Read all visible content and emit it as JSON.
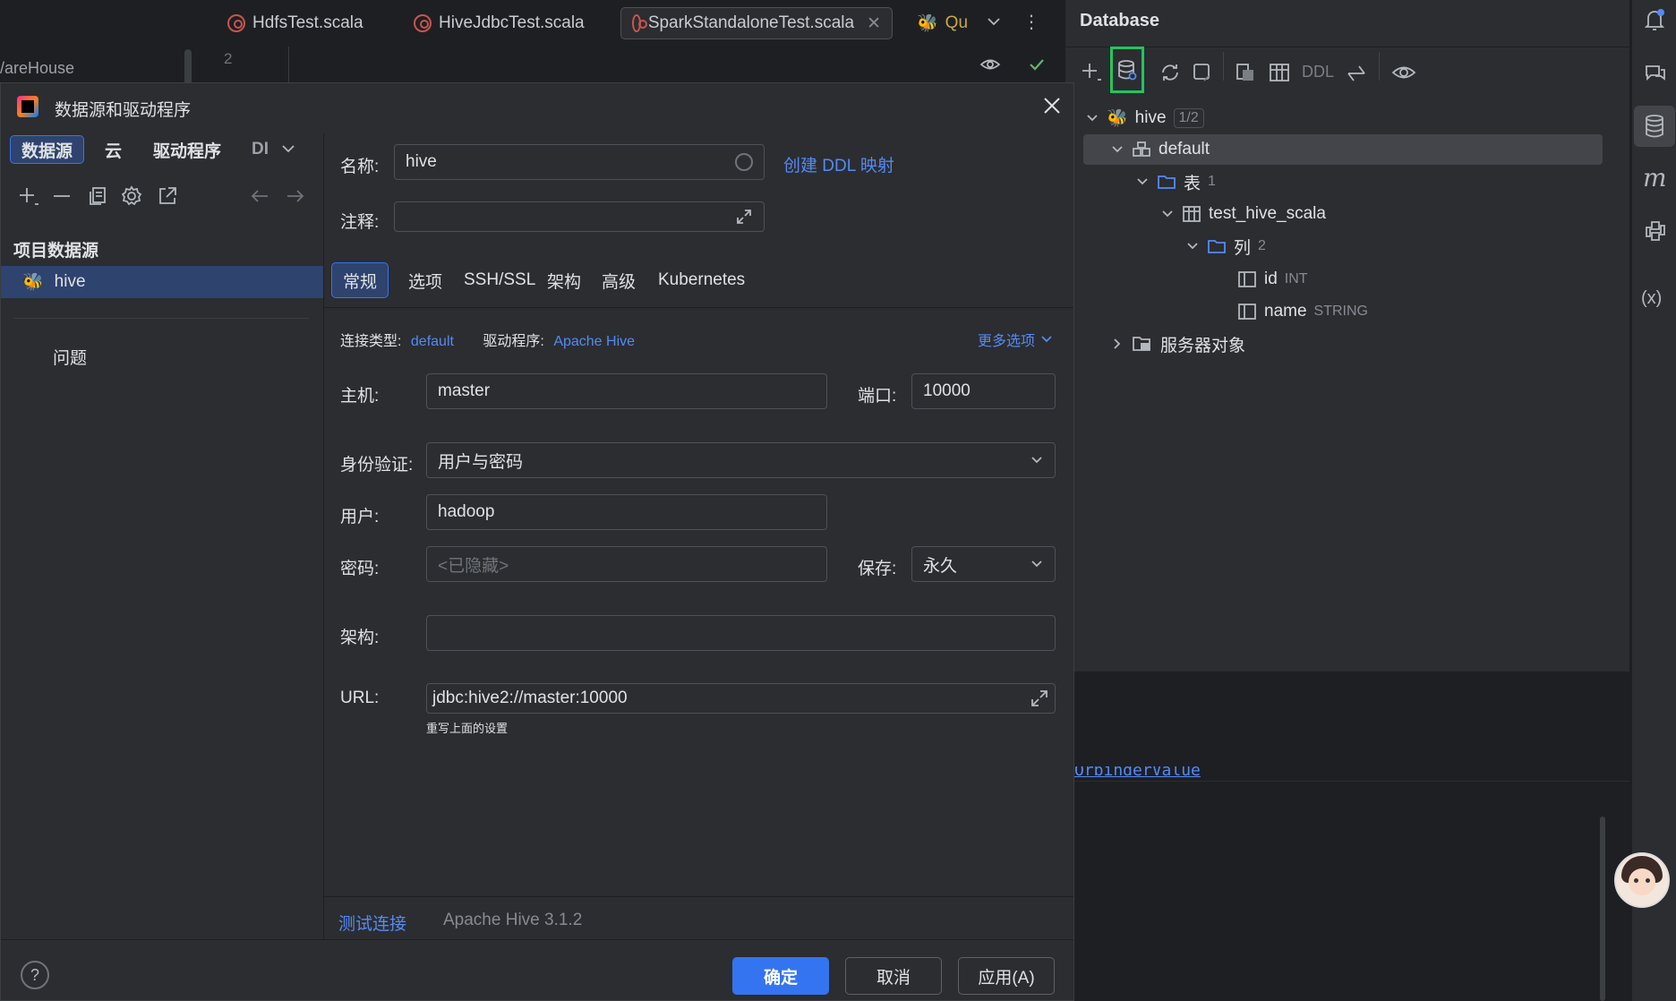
{
  "background": {
    "project_fragment": "/areHouse",
    "line_number": "2",
    "editor_tabs": [
      {
        "label": "HdfsTest.scala"
      },
      {
        "label": "HiveJdbcTest.scala"
      },
      {
        "label": "SparkStandaloneTest.scala"
      },
      {
        "label": "Qu"
      }
    ]
  },
  "database_panel": {
    "title": "Database",
    "toolbar_ddl": "DDL",
    "tree": {
      "hive_label": "hive",
      "hive_badge": "1/2",
      "default_label": "default",
      "tables_label": "表",
      "tables_count": "1",
      "table_name": "test_hive_scala",
      "columns_label": "列",
      "columns_count": "2",
      "col1_name": "id",
      "col1_type": "INT",
      "col2_name": "name",
      "col2_type": "STRING",
      "server_objects_label": "服务器对象"
    },
    "fragment_text": "OrbinderValue"
  },
  "dialog": {
    "title": "数据源和驱动程序",
    "left_tabs": {
      "datasource": "数据源",
      "cloud": "云",
      "drivers": "驱动程序",
      "more": "DI"
    },
    "section_title": "项目数据源",
    "selected_item": "hive",
    "problems": "问题",
    "name_label": "名称:",
    "name_value": "hive",
    "create_ddl_link": "创建 DDL 映射",
    "comment_label": "注释:",
    "comment_value": "",
    "subtabs": {
      "general": "常规",
      "options": "选项",
      "ssh": "SSH/SSL",
      "schemas": "架构",
      "advanced": "高级",
      "k8s": "Kubernetes"
    },
    "conn_type_label": "连接类型:",
    "conn_type_value": "default",
    "driver_label": "驱动程序:",
    "driver_value": "Apache Hive",
    "more_options": "更多选项",
    "host_label": "主机:",
    "host_value": "master",
    "port_label": "端口:",
    "port_value": "10000",
    "auth_label": "身份验证:",
    "auth_value": "用户与密码",
    "user_label": "用户:",
    "user_value": "hadoop",
    "password_label": "密码:",
    "password_placeholder": "<已隐藏>",
    "save_label": "保存:",
    "save_value": "永久",
    "schema_label": "架构:",
    "schema_value": "",
    "url_label": "URL:",
    "url_value": "jdbc:hive2://master:10000",
    "url_hint": "重写上面的设置",
    "test_connection": "测试连接",
    "driver_version": "Apache Hive 3.1.2",
    "help": "?",
    "ok_button": "确定",
    "cancel_button": "取消",
    "apply_button": "应用(A)"
  }
}
